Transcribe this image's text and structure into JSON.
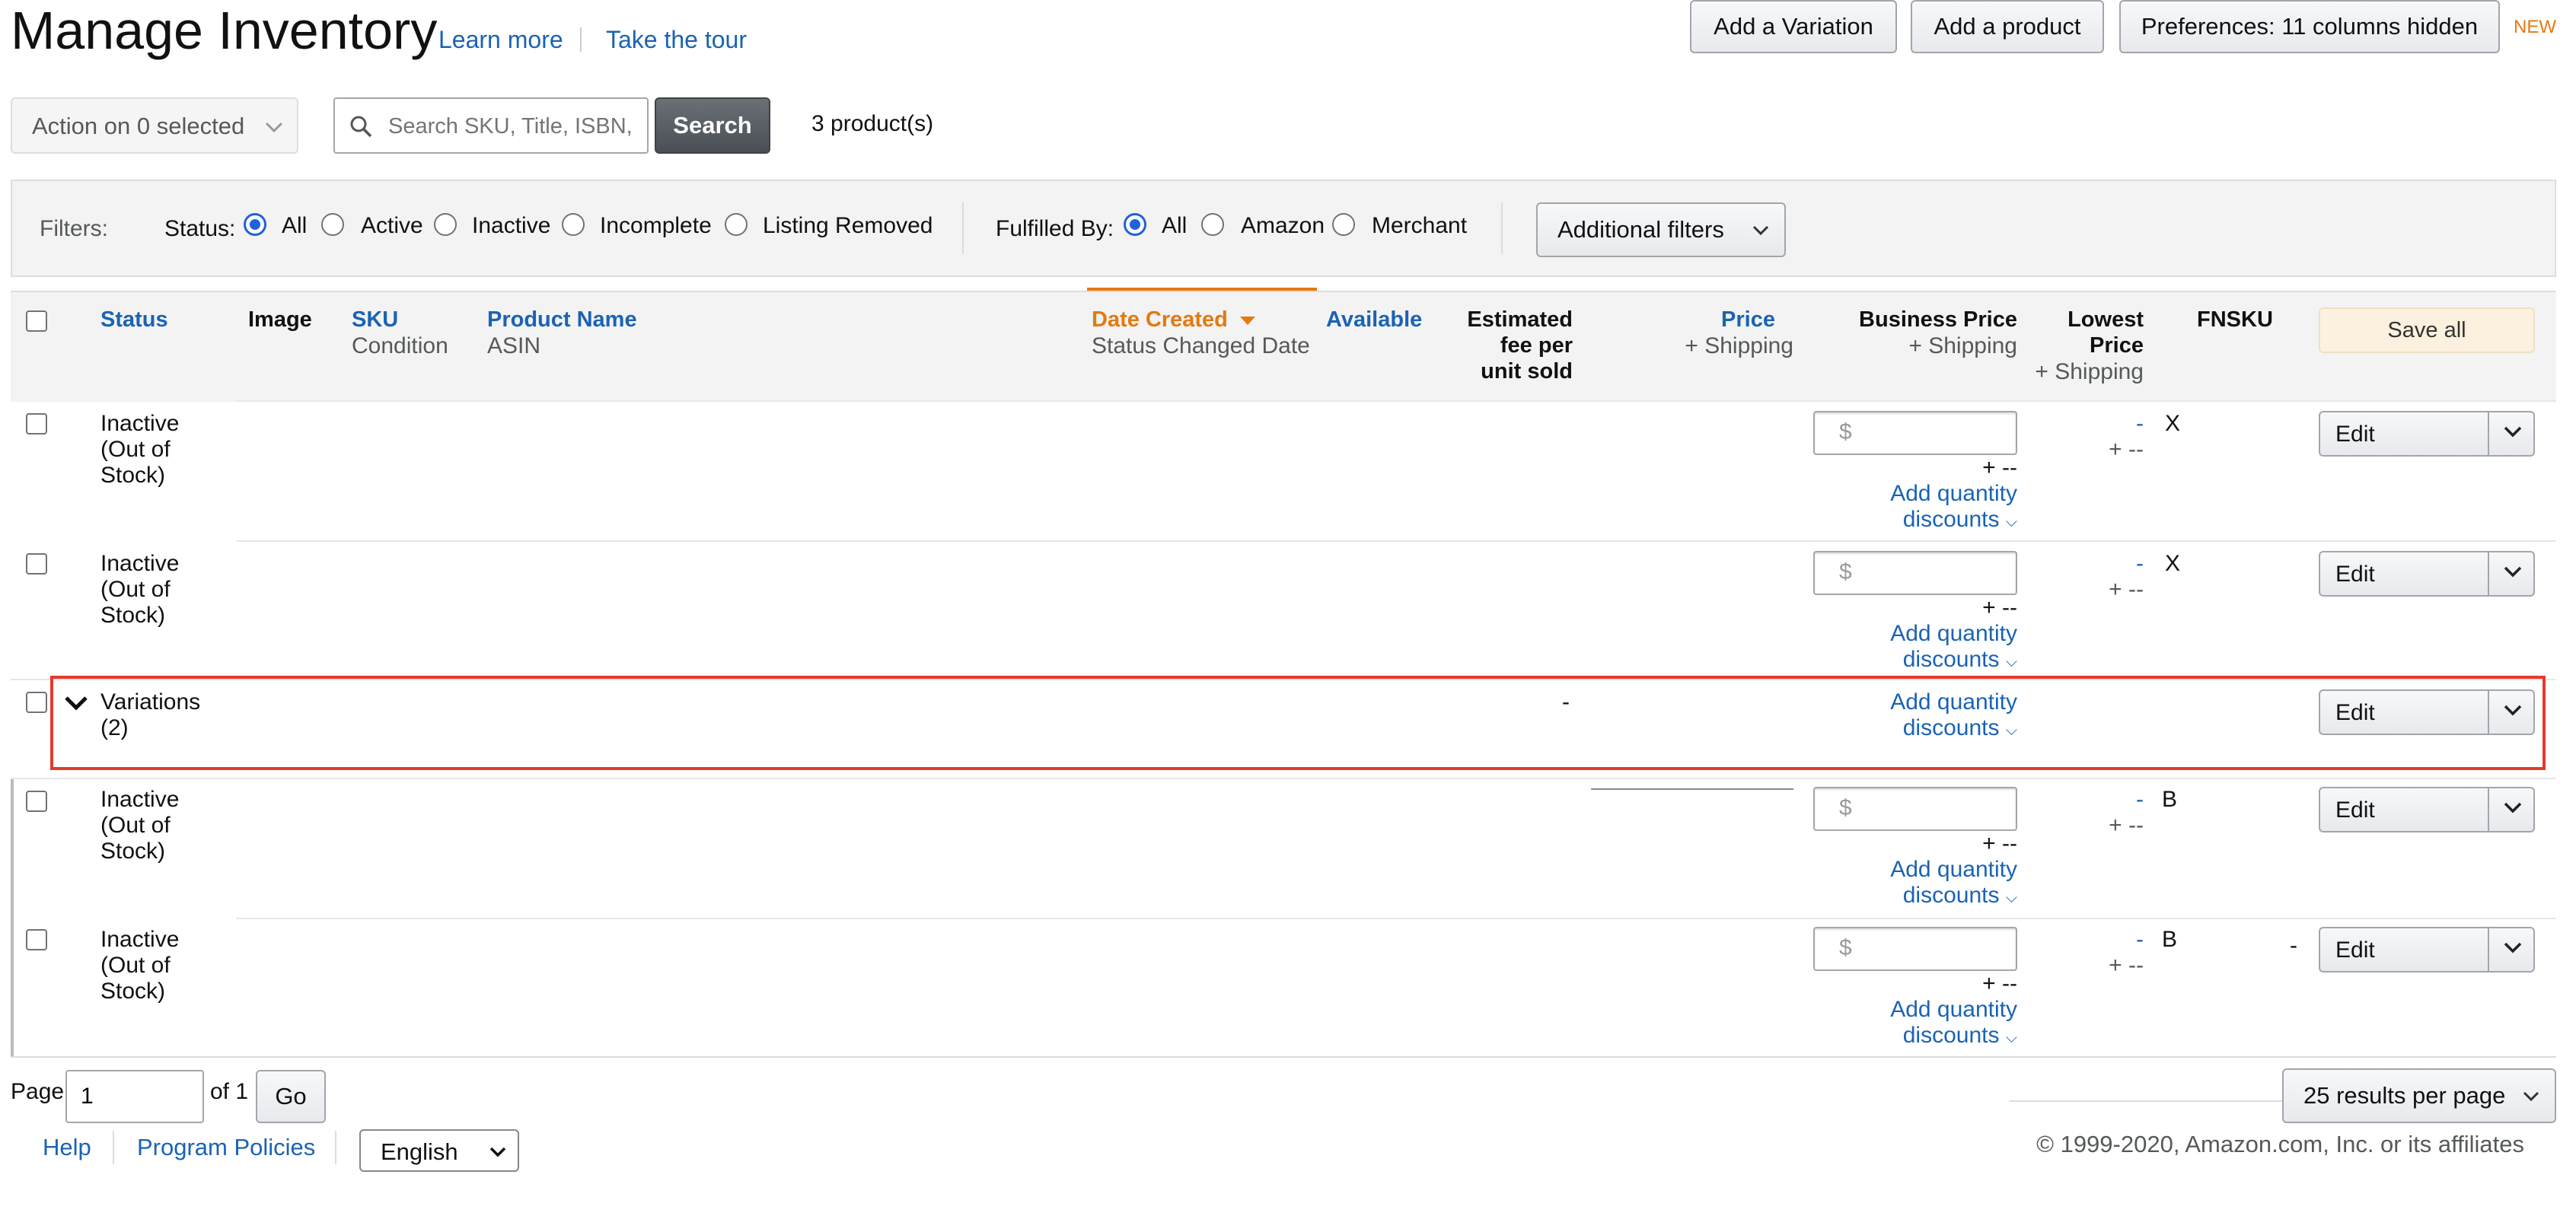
{
  "header": {
    "title": "Manage Inventory",
    "learn_more": "Learn more",
    "take_tour": "Take the tour",
    "add_variation": "Add a Variation",
    "add_product": "Add a product",
    "preferences": "Preferences: 11 columns hidden",
    "new_badge": "NEW"
  },
  "toolbar": {
    "action_dropdown": "Action on 0 selected",
    "search_placeholder": "Search SKU, Title, ISBN,",
    "search_button": "Search",
    "product_count": "3 product(s)"
  },
  "filters": {
    "label": "Filters:",
    "status_label": "Status:",
    "status_options": [
      "All",
      "Active",
      "Inactive",
      "Incomplete",
      "Listing Removed"
    ],
    "status_selected": "All",
    "fulfilled_label": "Fulfilled By:",
    "fulfilled_options": [
      "All",
      "Amazon",
      "Merchant"
    ],
    "fulfilled_selected": "All",
    "additional": "Additional filters"
  },
  "table": {
    "columns": {
      "status": "Status",
      "image": "Image",
      "sku": "SKU",
      "condition": "Condition",
      "product_name": "Product Name",
      "asin": "ASIN",
      "date_created": "Date Created",
      "status_changed": "Status Changed Date",
      "available": "Available",
      "est_fee_1": "Estimated",
      "est_fee_2": "fee per",
      "est_fee_3": "unit sold",
      "price": "Price",
      "price_shipping": "+ Shipping",
      "business_price": "Business Price",
      "business_shipping": "+ Shipping",
      "lowest_1": "Lowest",
      "lowest_2": "Price",
      "lowest_shipping": "+ Shipping",
      "fnsku": "FNSKU",
      "save_all": "Save all"
    },
    "rows": [
      {
        "status": [
          "Inactive",
          "(Out of",
          "Stock)"
        ],
        "price_placeholder": "$",
        "shipping": "+ --",
        "qty_1": "Add quantity",
        "qty_2": "discounts",
        "lowest": "-",
        "lowest_ship": "+ --",
        "fnsku": "X",
        "edit": "Edit"
      },
      {
        "status": [
          "Inactive",
          "(Out of",
          "Stock)"
        ],
        "price_placeholder": "$",
        "shipping": "+ --",
        "qty_1": "Add quantity",
        "qty_2": "discounts",
        "lowest": "-",
        "lowest_ship": "+ --",
        "fnsku": "X",
        "edit": "Edit"
      },
      {
        "status": [
          "Variations",
          "(2)"
        ],
        "fee": "-",
        "qty_1": "Add quantity",
        "qty_2": "discounts",
        "edit": "Edit"
      },
      {
        "status": [
          "Inactive",
          "(Out of",
          "Stock)"
        ],
        "price_placeholder": "$",
        "shipping": "+ --",
        "qty_1": "Add quantity",
        "qty_2": "discounts",
        "lowest": "-",
        "lowest_ship": "+ --",
        "fnsku": "B",
        "edit": "Edit"
      },
      {
        "status": [
          "Inactive",
          "(Out of",
          "Stock)"
        ],
        "price_placeholder": "$",
        "shipping": "+ --",
        "qty_1": "Add quantity",
        "qty_2": "discounts",
        "lowest": "-",
        "lowest_ship": "+ --",
        "fnsku": "B",
        "extra": "-",
        "edit": "Edit"
      }
    ]
  },
  "pagination": {
    "page_label": "Page",
    "page_value": "1",
    "of_label": "of 1",
    "go": "Go",
    "per_page": "25 results per page"
  },
  "footer": {
    "help": "Help",
    "policies": "Program Policies",
    "language": "English",
    "copyright": "© 1999-2020, Amazon.com, Inc. or its affiliates"
  },
  "colors": {
    "link": "#1a63b5",
    "sort_active": "#e47911",
    "highlight_border": "#e53a2b",
    "radio_selected": "#2162d8"
  }
}
